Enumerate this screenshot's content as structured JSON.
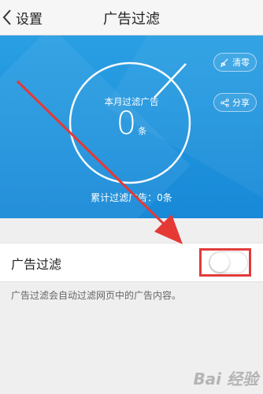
{
  "header": {
    "back_label": "设置",
    "title": "广告过滤"
  },
  "stats": {
    "monthly_label": "本月过滤广告",
    "monthly_count": "0",
    "monthly_unit": "条",
    "total_label": "累计过滤广告：0条"
  },
  "actions": {
    "clear_label": "清零",
    "share_label": "分享"
  },
  "setting": {
    "label": "广告过滤",
    "enabled": false,
    "description": "广告过滤会自动过滤网页中的广告内容。"
  },
  "watermark": "Bai 经验",
  "colors": {
    "hero_blue": "#1e93dc",
    "annotation_red": "#e23b3b"
  }
}
